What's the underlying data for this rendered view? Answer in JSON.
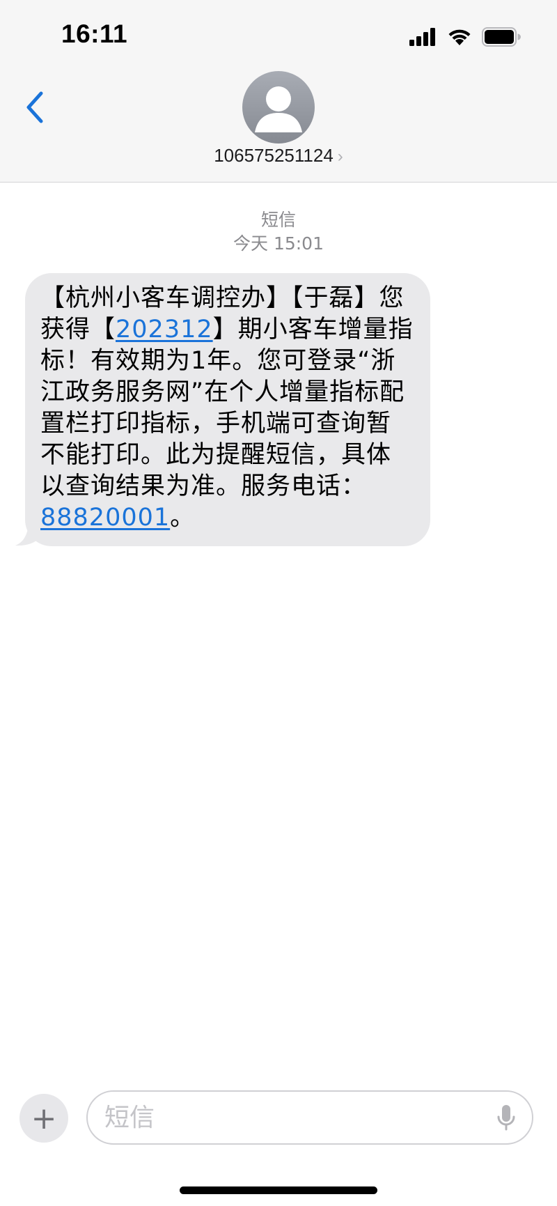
{
  "status_bar": {
    "time": "16:11"
  },
  "header": {
    "contact": "106575251124",
    "contact_chevron": "›"
  },
  "conversation": {
    "message_type": "短信",
    "timestamp": "今天 15:01",
    "message": {
      "part1": "【杭州小客车调控办】【于磊】您获得【",
      "period_link": "202312",
      "part2": "】期小客车增量指标！有效期为1年。您可登录“浙江政务服务网”在个人增量指标配置栏打印指标，手机端可查询暂不能打印。此为提醒短信，具体以查询结果为准。服务电话：",
      "phone_link": "88820001",
      "part3": "。"
    }
  },
  "composer": {
    "add_label": "+",
    "input_value": "",
    "placeholder": "短信"
  },
  "icons": {
    "back": "back-chevron-icon",
    "avatar": "person-icon",
    "signal": "cellular-signal-icon",
    "wifi": "wifi-icon",
    "battery": "battery-icon",
    "mic": "microphone-icon"
  },
  "colors": {
    "accent": "#1a73d9",
    "bubble": "#e9e9eb",
    "header_bg": "#f6f6f6",
    "meta_text": "#8a8a8e"
  }
}
